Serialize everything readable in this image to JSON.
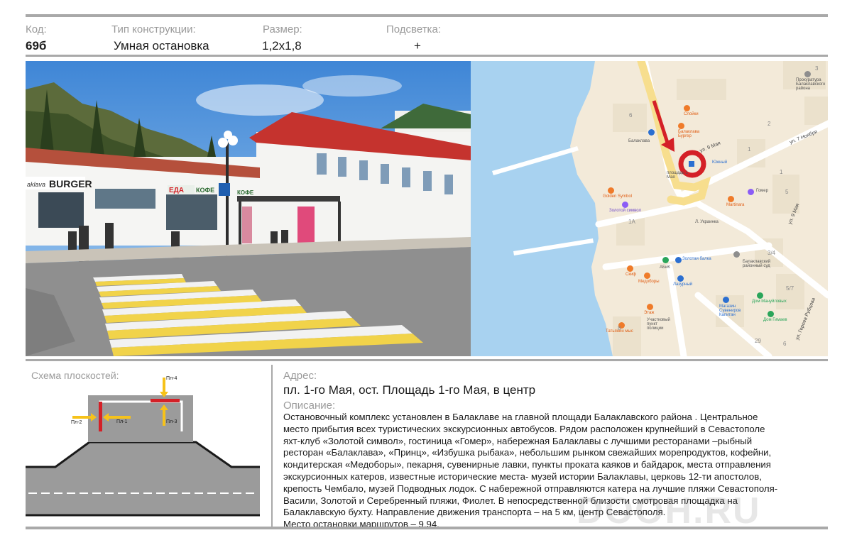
{
  "header": {
    "code_label": "Код:",
    "code_value": "69б",
    "type_label": "Тип конструкции:",
    "type_value": "Умная остановка",
    "size_label": "Размер:",
    "size_value": "1,2x1,8",
    "light_label": "Подсветка:",
    "light_value": "+"
  },
  "photo": {
    "burger_sign": "BURGER",
    "burger_sign_prefix": "aklava",
    "eda_sign": "ЕДА",
    "kofe_sign": "КОФЕ",
    "kofe_sign_2": "КОФЕ"
  },
  "map": {
    "labels": {
      "prokuratura": "Прокуратура Балаклавского района",
      "sloiki": "Слойки",
      "balaklava_burger": "Балаклава Бургер",
      "balaklava": "Балаклава",
      "ul_9_maya": "ул. 9 Мая",
      "ul_9_maya_2": "ул. 9 Мая",
      "ul_7_noyabrya": "ул. 7 Ноября",
      "yuzhny": "Южный",
      "ploshad": "площадь 1 Мая",
      "golden_symbol": "Golden Symbol",
      "zolotoy_simvol": "Золотой символ",
      "gomer": "Гомер",
      "martinara": "Martinara",
      "l_ukrainka": "Л. Украинка",
      "abik": "АБиК",
      "zolotaya_balka": "Золотая балка",
      "skif": "Скиф",
      "medobory": "Медоборы",
      "lazurny": "Лазурный",
      "balaklavsky_sud": "Балаклавский районный суд",
      "etaje": "Этаж",
      "magazin_suvenirov": "Магазин Сувениров Капитан",
      "dom_manuilov": "Дом Мануйловых",
      "dom_gimaev": "Дом Гимаев",
      "uchastkovy": "Участковый пункт полиции",
      "tatyanin": "Татьянин мыс",
      "ul_geroev": "ул. Героев Рубцова",
      "n6": "6",
      "n3": "3",
      "n2": "2",
      "n1": "1",
      "n1b": "1",
      "n5": "5",
      "n1a": "1А",
      "n34": "3/4",
      "n57": "5/7",
      "n8": "8",
      "n29": "29",
      "n6b": "6"
    }
  },
  "scheme": {
    "title": "Схема плоскостей:",
    "pl1": "Пл-1",
    "pl2": "Пл-2",
    "pl3": "Пл-3",
    "pl4": "Пл-4"
  },
  "address": {
    "label": "Адрес:",
    "value": "пл. 1-го Мая, ост. Площадь 1-го Мая,  в центр"
  },
  "description": {
    "label": "Описание:",
    "lines": [
      "Остановочный комплекс установлен  в Балаклаве  на главной площади Балаклавского района . Центральное",
      "место прибытия всех туристических экскурсионных  автобусов. Рядом расположен крупнейший в Севастополе",
      "яхт-клуб «Золотой символ», гостиница «Гомер», набережная Балаклавы с  лучшими ресторанами –рыбный",
      "ресторан «Балаклава», «Принц», «Избушка рыбака», небольшим рынком свежайших морепродуктов, кофейни,",
      "кондитерская «Медоборы», пекарня,  сувенирные лавки, пункты проката каяков и байдарок, места отправления",
      "экскурсионных катеров, известные исторические места- музей истории Балаклавы, церковь 12-ти апостолов,",
      "крепость Чембало, музей Подводных лодок. С набережной отправляются катера на лучшие пляжи Севастополя-",
      "Васили, Золотой и Серебренный пляжи, Фиолет. В непосредственной близости  смотровая площадка на",
      "Балаклавскую бухту. Направление движения транспорта  –  на 5 км, центр Севастополя.",
      "Место остановки маршрутов – 9,94."
    ]
  },
  "watermark": "DOOH.RU",
  "colors": {
    "accent_red": "#d42027",
    "arrow_yellow": "#f6c21a",
    "road_gray": "#9b9b9b",
    "sea_blue": "#a8d2f0"
  }
}
